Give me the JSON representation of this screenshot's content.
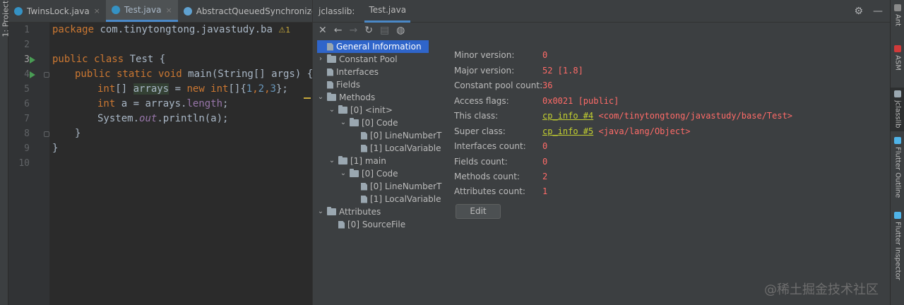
{
  "left_strip": {
    "label": "1: Project"
  },
  "editor_tabs": [
    {
      "label": "TwinsLock.java",
      "active": false
    },
    {
      "label": "Test.java",
      "active": true
    },
    {
      "label": "AbstractQueuedSynchronizer.java",
      "active": false
    }
  ],
  "close_glyph": "×",
  "line_numbers": [
    "1",
    "2",
    "3",
    "4",
    "5",
    "6",
    "7",
    "8",
    "9",
    "10"
  ],
  "code": {
    "l1_kw": "package",
    "l1_rest": " com.tinytongtong.javastudy.ba",
    "l1_badge": "⚠1",
    "l3_kw": "public class",
    "l3_rest": " Test {",
    "l4_kw": "public static void",
    "l4_rest": " main(String[] args) {",
    "l5_kw1": "int",
    "l5_mid1": "[] ",
    "l5_var": "arrays",
    "l5_mid2": " = ",
    "l5_kw2": "new int",
    "l5_mid3": "[]{",
    "l5_n1": "1",
    "l5_c1": ",",
    "l5_n2": "2",
    "l5_c2": ",",
    "l5_n3": "3",
    "l5_end": "};",
    "l6_kw": "int",
    "l6_mid": " a = arrays.",
    "l6_fld": "length",
    "l6_end": ";",
    "l7_a": "System.",
    "l7_fld": "out",
    "l7_b": ".println(a);",
    "l8": "}",
    "l9": "}"
  },
  "jpanel": {
    "title": "jclasslib:",
    "tab": "Test.java",
    "header_icons": {
      "settings": "⚙",
      "minimize": "—"
    },
    "toolbar": {
      "close": "✕",
      "back": "←",
      "forward": "→",
      "refresh": "↻",
      "save": "▤",
      "web": "◍"
    }
  },
  "tree": [
    {
      "label": "General Information",
      "selected": true
    },
    {
      "label": "Constant Pool"
    },
    {
      "label": "Interfaces"
    },
    {
      "label": "Fields"
    },
    {
      "label": "Methods"
    },
    {
      "label": "[0] <init>"
    },
    {
      "label": "[0] Code"
    },
    {
      "label": "[0] LineNumberT"
    },
    {
      "label": "[1] LocalVariable"
    },
    {
      "label": "[1] main"
    },
    {
      "label": "[0] Code"
    },
    {
      "label": "[0] LineNumberT"
    },
    {
      "label": "[1] LocalVariable"
    },
    {
      "label": "Attributes"
    },
    {
      "label": "[0] SourceFile"
    }
  ],
  "tree_arrows": {
    "collapsed": "›",
    "expanded": "⌄"
  },
  "general_info": {
    "minor_version": {
      "label": "Minor version:",
      "value": "0"
    },
    "major_version": {
      "label": "Major version:",
      "value": "52 [1.8]"
    },
    "constant_pool_count": {
      "label": "Constant pool count:",
      "value": "36"
    },
    "access_flags": {
      "label": "Access flags:",
      "value": "0x0021 [public]"
    },
    "this_class": {
      "label": "This class:",
      "link": "cp_info #4",
      "value": "<com/tinytongtong/javastudy/base/Test>"
    },
    "super_class": {
      "label": "Super class:",
      "link": "cp_info #5",
      "value": "<java/lang/Object>"
    },
    "interfaces_count": {
      "label": "Interfaces count:",
      "value": "0"
    },
    "fields_count": {
      "label": "Fields count:",
      "value": "0"
    },
    "methods_count": {
      "label": "Methods count:",
      "value": "2"
    },
    "attributes_count": {
      "label": "Attributes count:",
      "value": "1"
    },
    "edit_label": "Edit"
  },
  "right_strip": [
    {
      "label": "Ant"
    },
    {
      "label": "ASM"
    },
    {
      "label": "jclasslib",
      "active": true
    },
    {
      "label": "Flutter Outline"
    },
    {
      "label": "Flutter Inspector"
    }
  ],
  "watermark": "@稀土掘金技术社区",
  "colors": {
    "accent": "#4a88c7",
    "selection": "#2f65ca",
    "value_red": "#ff6b68",
    "link_yellow": "#c4d130",
    "keyword": "#cc7832",
    "number": "#6897bb"
  }
}
